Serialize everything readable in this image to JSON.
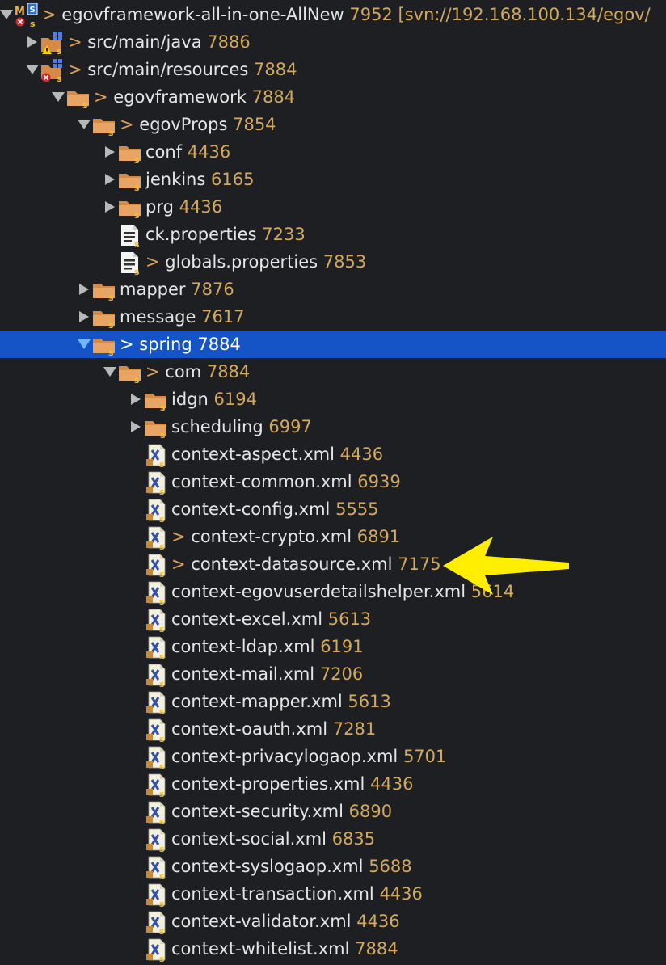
{
  "colors": {
    "background": "#1e1f22",
    "selection": "#1454c6",
    "text": "#e6e6e6",
    "revision": "#d2a95e",
    "folder": "#d58a46",
    "annotation_arrow": "#ffee00"
  },
  "tree": [
    {
      "id": "root",
      "depth": 0,
      "twisty": "down",
      "icon": "project-icon",
      "dirty": true,
      "name": "egovframework-all-in-one-AllNew",
      "rev": "7952 [svn://192.168.100.134/egov/"
    },
    {
      "id": "src-main-java",
      "depth": 1,
      "twisty": "right",
      "icon": "package-folder-warning-icon",
      "dirty": true,
      "name": "src/main/java",
      "rev": "7886"
    },
    {
      "id": "src-main-resources",
      "depth": 1,
      "twisty": "down",
      "icon": "package-folder-error-icon",
      "dirty": true,
      "name": "src/main/resources",
      "rev": "7884"
    },
    {
      "id": "egovframework",
      "depth": 2,
      "twisty": "down",
      "icon": "folder-icon",
      "dirty": true,
      "name": "egovframework",
      "rev": "7884"
    },
    {
      "id": "egovprops",
      "depth": 3,
      "twisty": "down",
      "icon": "folder-icon",
      "dirty": true,
      "name": "egovProps",
      "rev": "7854"
    },
    {
      "id": "conf",
      "depth": 4,
      "twisty": "right",
      "icon": "folder-icon",
      "dirty": false,
      "name": "conf",
      "rev": "4436"
    },
    {
      "id": "jenkins",
      "depth": 4,
      "twisty": "right",
      "icon": "folder-icon",
      "dirty": false,
      "name": "jenkins",
      "rev": "6165"
    },
    {
      "id": "prg",
      "depth": 4,
      "twisty": "right",
      "icon": "folder-icon",
      "dirty": false,
      "name": "prg",
      "rev": "4436"
    },
    {
      "id": "ck-properties",
      "depth": 4,
      "twisty": "none",
      "icon": "properties-file-icon",
      "dirty": false,
      "name": "ck.properties",
      "rev": "7233"
    },
    {
      "id": "globals-properties",
      "depth": 4,
      "twisty": "none",
      "icon": "properties-file-icon",
      "dirty": true,
      "name": "globals.properties",
      "rev": "7853"
    },
    {
      "id": "mapper",
      "depth": 3,
      "twisty": "right",
      "icon": "folder-icon",
      "dirty": false,
      "name": "mapper",
      "rev": "7876"
    },
    {
      "id": "message",
      "depth": 3,
      "twisty": "right",
      "icon": "folder-icon",
      "dirty": false,
      "name": "message",
      "rev": "7617"
    },
    {
      "id": "spring",
      "depth": 3,
      "twisty": "down",
      "icon": "folder-icon",
      "dirty": true,
      "name": "spring",
      "rev": "7884",
      "selected": true
    },
    {
      "id": "com",
      "depth": 4,
      "twisty": "down",
      "icon": "folder-icon",
      "dirty": true,
      "name": "com",
      "rev": "7884"
    },
    {
      "id": "idgn",
      "depth": 5,
      "twisty": "right",
      "icon": "folder-icon",
      "dirty": false,
      "name": "idgn",
      "rev": "6194"
    },
    {
      "id": "scheduling",
      "depth": 5,
      "twisty": "right",
      "icon": "folder-icon",
      "dirty": false,
      "name": "scheduling",
      "rev": "6997"
    },
    {
      "id": "context-aspect",
      "depth": 5,
      "twisty": "none",
      "icon": "xml-file-icon",
      "dirty": false,
      "name": "context-aspect.xml",
      "rev": "4436"
    },
    {
      "id": "context-common",
      "depth": 5,
      "twisty": "none",
      "icon": "xml-file-icon",
      "dirty": false,
      "name": "context-common.xml",
      "rev": "6939"
    },
    {
      "id": "context-config",
      "depth": 5,
      "twisty": "none",
      "icon": "xml-file-icon",
      "dirty": false,
      "name": "context-config.xml",
      "rev": "5555"
    },
    {
      "id": "context-crypto",
      "depth": 5,
      "twisty": "none",
      "icon": "xml-file-icon",
      "dirty": true,
      "name": "context-crypto.xml",
      "rev": "6891"
    },
    {
      "id": "context-datasource",
      "depth": 5,
      "twisty": "none",
      "icon": "xml-file-icon",
      "dirty": true,
      "name": "context-datasource.xml",
      "rev": "7175"
    },
    {
      "id": "context-egovuserdetailshelper",
      "depth": 5,
      "twisty": "none",
      "icon": "xml-file-icon",
      "dirty": false,
      "name": "context-egovuserdetailshelper.xml",
      "rev": "5614"
    },
    {
      "id": "context-excel",
      "depth": 5,
      "twisty": "none",
      "icon": "xml-file-icon",
      "dirty": false,
      "name": "context-excel.xml",
      "rev": "5613"
    },
    {
      "id": "context-ldap",
      "depth": 5,
      "twisty": "none",
      "icon": "xml-file-icon",
      "dirty": false,
      "name": "context-ldap.xml",
      "rev": "6191"
    },
    {
      "id": "context-mail",
      "depth": 5,
      "twisty": "none",
      "icon": "xml-file-icon",
      "dirty": false,
      "name": "context-mail.xml",
      "rev": "7206"
    },
    {
      "id": "context-mapper",
      "depth": 5,
      "twisty": "none",
      "icon": "xml-file-icon",
      "dirty": false,
      "name": "context-mapper.xml",
      "rev": "5613"
    },
    {
      "id": "context-oauth",
      "depth": 5,
      "twisty": "none",
      "icon": "xml-file-icon",
      "dirty": false,
      "name": "context-oauth.xml",
      "rev": "7281"
    },
    {
      "id": "context-privacylogaop",
      "depth": 5,
      "twisty": "none",
      "icon": "xml-file-icon",
      "dirty": false,
      "name": "context-privacylogaop.xml",
      "rev": "5701"
    },
    {
      "id": "context-properties",
      "depth": 5,
      "twisty": "none",
      "icon": "xml-file-icon",
      "dirty": false,
      "name": "context-properties.xml",
      "rev": "4436"
    },
    {
      "id": "context-security",
      "depth": 5,
      "twisty": "none",
      "icon": "xml-file-icon",
      "dirty": false,
      "name": "context-security.xml",
      "rev": "6890"
    },
    {
      "id": "context-social",
      "depth": 5,
      "twisty": "none",
      "icon": "xml-file-icon",
      "dirty": false,
      "name": "context-social.xml",
      "rev": "6835"
    },
    {
      "id": "context-syslogaop",
      "depth": 5,
      "twisty": "none",
      "icon": "xml-file-icon",
      "dirty": false,
      "name": "context-syslogaop.xml",
      "rev": "5688"
    },
    {
      "id": "context-transaction",
      "depth": 5,
      "twisty": "none",
      "icon": "xml-file-icon",
      "dirty": false,
      "name": "context-transaction.xml",
      "rev": "4436"
    },
    {
      "id": "context-validator",
      "depth": 5,
      "twisty": "none",
      "icon": "xml-file-icon",
      "dirty": false,
      "name": "context-validator.xml",
      "rev": "4436"
    },
    {
      "id": "context-whitelist",
      "depth": 5,
      "twisty": "none",
      "icon": "xml-file-icon",
      "dirty": false,
      "name": "context-whitelist.xml",
      "rev": "7884"
    }
  ],
  "annotation": {
    "icon": "yellow-arrow-icon",
    "points_to": "context-datasource"
  }
}
